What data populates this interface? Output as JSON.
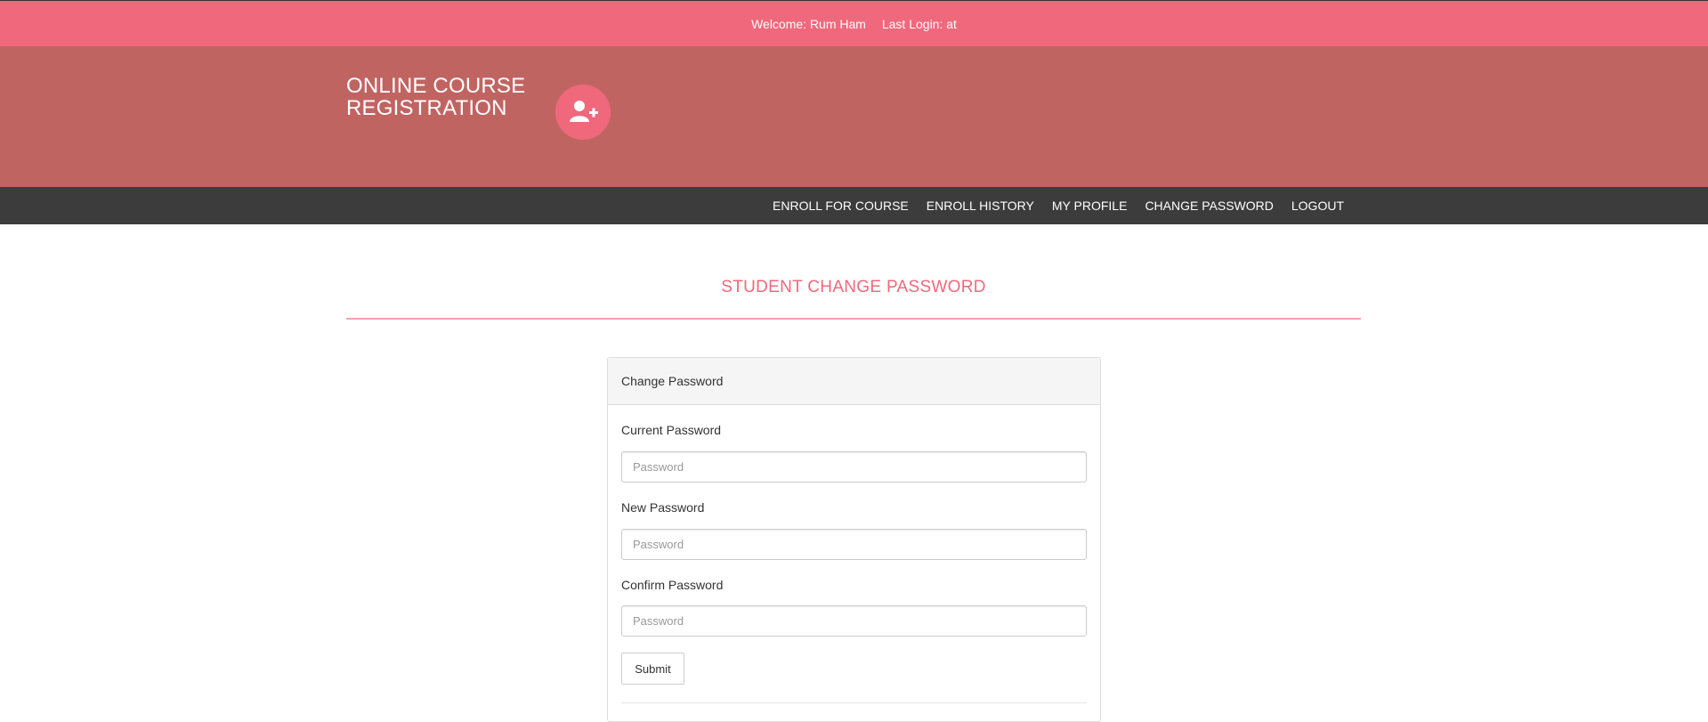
{
  "topbar": {
    "welcome": "Welcome: Rum Ham",
    "last_login": "Last Login: at"
  },
  "header": {
    "logo_line1": "Online Course",
    "logo_line2": "Registration",
    "logo_icon": "user-plus-icon"
  },
  "nav": {
    "items": [
      {
        "label": "Enroll for Course"
      },
      {
        "label": "Enroll History"
      },
      {
        "label": "My Profile"
      },
      {
        "label": "Change Password"
      },
      {
        "label": "Logout"
      }
    ]
  },
  "page": {
    "title": "Student Change Password"
  },
  "form": {
    "heading": "Change Password",
    "current_label": "Current Password",
    "current_placeholder": "Password",
    "current_value": "",
    "new_label": "New Password",
    "new_placeholder": "Password",
    "new_value": "",
    "confirm_label": "Confirm Password",
    "confirm_placeholder": "Password",
    "confirm_value": "",
    "submit_label": "Submit"
  },
  "colors": {
    "topbar": "#f0687c",
    "header": "#c06462",
    "navbar": "#3c3c3c",
    "accent": "#f0687c"
  }
}
